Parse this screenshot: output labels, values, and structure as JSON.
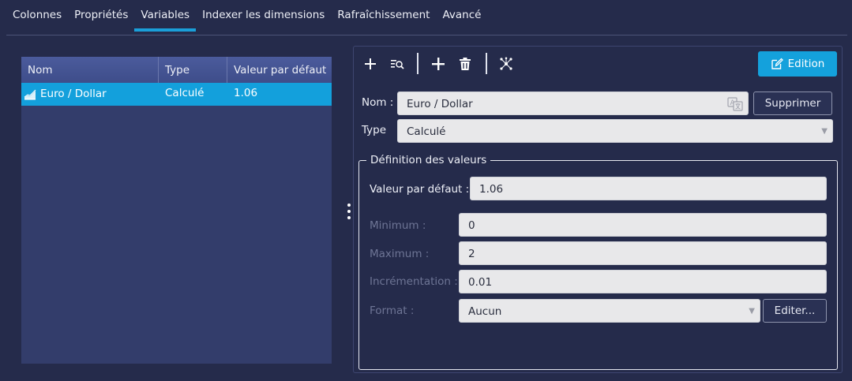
{
  "tabs": [
    "Colonnes",
    "Propriétés",
    "Variables",
    "Indexer les dimensions",
    "Rafraîchissement",
    "Avancé"
  ],
  "active_tab": "Variables",
  "table": {
    "columns": [
      "Nom",
      "Type",
      "Valeur par défaut"
    ],
    "rows": [
      {
        "nom": "Euro / Dollar",
        "type": "Calculé",
        "valeur": "1.06"
      }
    ]
  },
  "toolbar": {
    "edit_label": "Edition",
    "icons": [
      "plus-icon",
      "search-list-icon",
      "move-icon",
      "trash-icon",
      "network-icon",
      "pencil-icon"
    ]
  },
  "form": {
    "nom_label": "Nom :",
    "nom_value": "Euro / Dollar",
    "delete_label": "Supprimer",
    "type_label": "Type",
    "type_value": "Calculé",
    "group_title": "Définition des valeurs",
    "default_label": "Valeur par défaut :",
    "default_value": "1.06",
    "min_label": "Minimum :",
    "min_value": "0",
    "max_label": "Maximum :",
    "max_value": "2",
    "step_label": "Incrémentation :",
    "step_value": "0.01",
    "format_label": "Format :",
    "format_value": "Aucun",
    "format_edit_label": "Editer..."
  },
  "colors": {
    "background": "#252b4b",
    "accent": "#14a1dc",
    "table_header": "#4b5b9c",
    "table_body": "#333d6b"
  }
}
